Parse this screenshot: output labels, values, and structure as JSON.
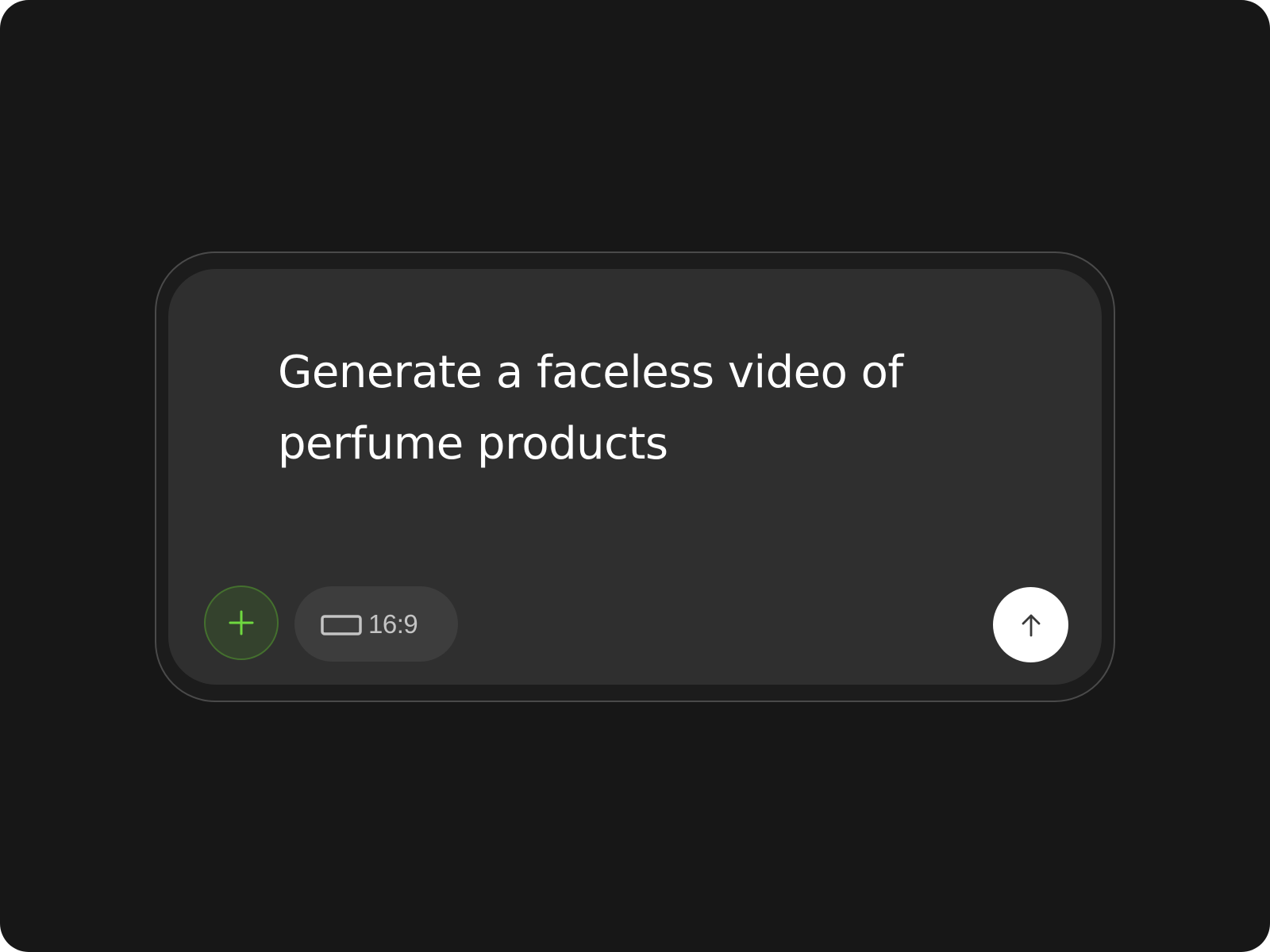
{
  "composer": {
    "prompt_text": "Generate a faceless video of perfume products",
    "add_button": {
      "icon": "plus-icon",
      "color": "#6fd83f"
    },
    "aspect_ratio": {
      "icon": "aspect-ratio-icon",
      "label": "16:9"
    },
    "send_button": {
      "icon": "arrow-up-icon"
    }
  },
  "colors": {
    "background": "#171717",
    "composer_surface": "#2f2f2f",
    "accent_green": "#6fd83f",
    "text_primary": "#ffffff",
    "text_secondary": "#c4c4c4"
  }
}
